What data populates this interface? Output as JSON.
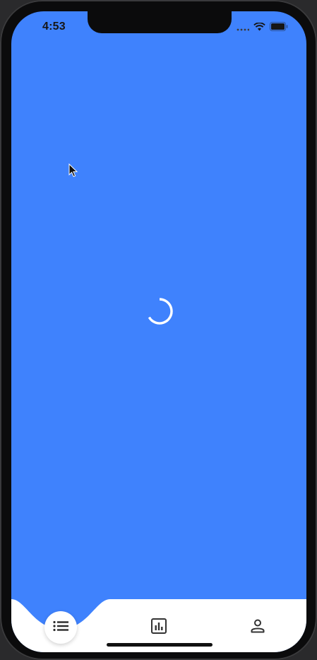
{
  "status_bar": {
    "time": "4:53",
    "icons": [
      "cellular-signal-icon",
      "wifi-icon",
      "battery-icon"
    ]
  },
  "screen": {
    "background_color": "#3F82FD",
    "state": "loading"
  },
  "tab_bar": {
    "items": [
      {
        "name": "list",
        "icon": "list-icon",
        "active": true
      },
      {
        "name": "stats",
        "icon": "bar-chart-icon",
        "active": false
      },
      {
        "name": "profile",
        "icon": "person-icon",
        "active": false
      }
    ]
  }
}
